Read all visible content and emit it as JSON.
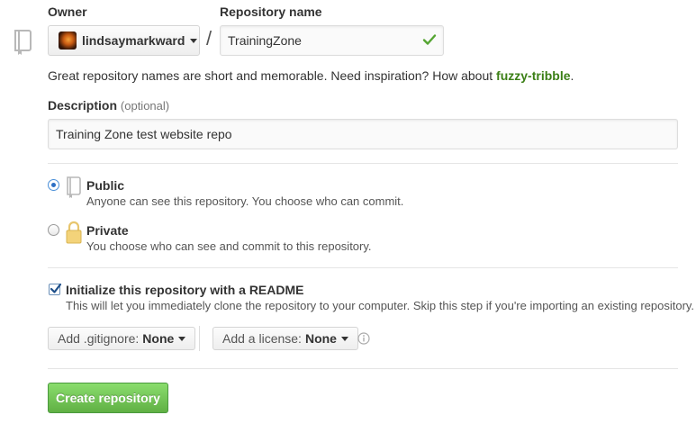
{
  "owner": {
    "label": "Owner",
    "selected": "lindsaymarkward"
  },
  "repo_name": {
    "label": "Repository name",
    "value": "TrainingZone",
    "valid": true
  },
  "separator": "/",
  "hint": {
    "text": "Great repository names are short and memorable. Need inspiration? How about ",
    "suggestion": "fuzzy-tribble",
    "suffix": "."
  },
  "description": {
    "label": "Description",
    "optional": "(optional)",
    "value": "Training Zone test website repo"
  },
  "visibility": {
    "selected": "public",
    "public": {
      "title": "Public",
      "desc": "Anyone can see this repository. You choose who can commit.",
      "icon": "repo-icon"
    },
    "private": {
      "title": "Private",
      "desc": "You choose who can see and commit to this repository.",
      "icon": "lock-icon"
    }
  },
  "readme": {
    "checked": true,
    "title": "Initialize this repository with a README",
    "desc": "This will let you immediately clone the repository to your computer. Skip this step if you're importing an existing repository."
  },
  "gitignore": {
    "label": "Add .gitignore:",
    "value": "None"
  },
  "license": {
    "label": "Add a license:",
    "value": "None"
  },
  "create_button": "Create repository",
  "colors": {
    "primary_green": "#60b044",
    "suggestion_green": "#3b7f16",
    "check_green": "#55a532"
  }
}
